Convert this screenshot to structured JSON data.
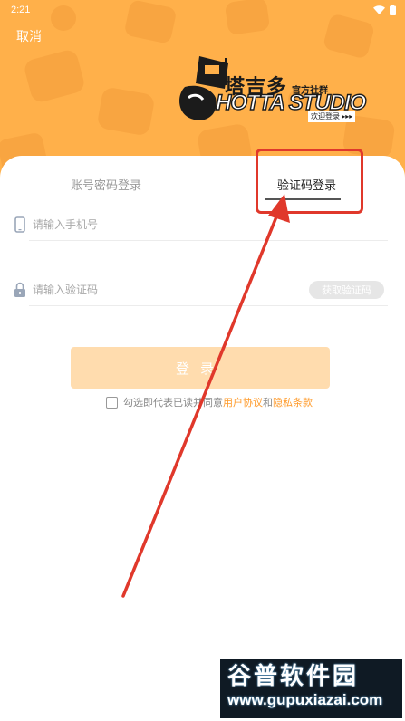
{
  "status_bar": {
    "time": "2:21"
  },
  "header": {
    "cancel_label": "取消",
    "logo": {
      "title": "塔吉多",
      "subtitle": "官方社群",
      "studio": "HOTTA STUDIO",
      "welcome": "欢迎登录 ▸▸▸"
    }
  },
  "tabs": {
    "password_login": "账号密码登录",
    "code_login": "验证码登录"
  },
  "form": {
    "phone_placeholder": "请输入手机号",
    "code_placeholder": "请输入验证码",
    "get_code_label": "获取验证码",
    "login_label": "登录"
  },
  "agreement": {
    "prefix": "勾选即代表已读并同意",
    "user_agreement": "用户协议",
    "and": "和",
    "privacy_policy": "隐私条款"
  },
  "watermark": {
    "title": "谷普软件园",
    "url": "www.gupuxiazai.com"
  },
  "colors": {
    "header_orange": "#ffb04a",
    "accent_link": "#ff9b2b",
    "login_button": "#ffdcae",
    "annotation_red": "#e0382b"
  }
}
